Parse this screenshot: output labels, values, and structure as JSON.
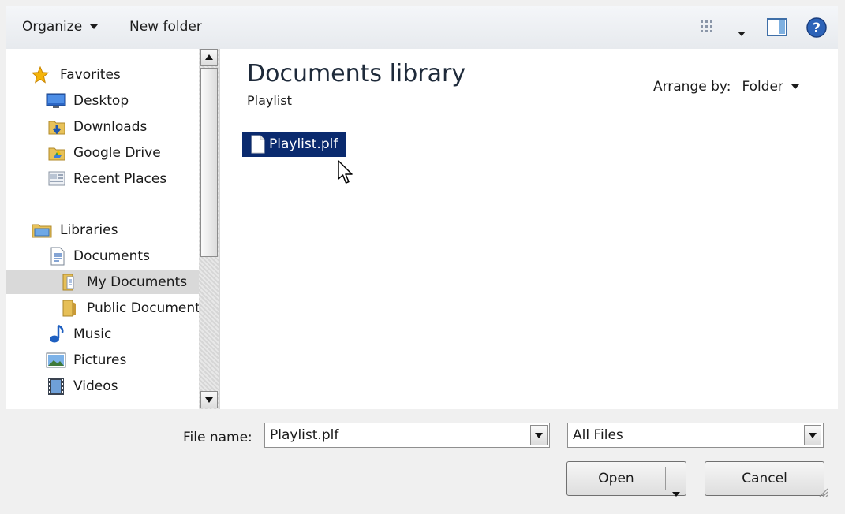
{
  "toolbar": {
    "organize_label": "Organize",
    "new_folder_label": "New folder",
    "icons": [
      "views-icon",
      "view-options-arrow-icon",
      "preview-pane-icon",
      "help-icon"
    ]
  },
  "nav": {
    "favorites": {
      "label": "Favorites",
      "items": [
        {
          "label": "Desktop",
          "icon": "desktop-icon"
        },
        {
          "label": "Downloads",
          "icon": "downloads-icon"
        },
        {
          "label": "Google Drive",
          "icon": "google-drive-icon"
        },
        {
          "label": "Recent Places",
          "icon": "recent-places-icon"
        }
      ]
    },
    "libraries": {
      "label": "Libraries",
      "items": [
        {
          "label": "Documents",
          "icon": "documents-icon"
        },
        {
          "label": "My Documents",
          "icon": "folder-icon",
          "selected": true
        },
        {
          "label": "Public Documents",
          "icon": "folder-icon"
        },
        {
          "label": "Music",
          "icon": "music-icon"
        },
        {
          "label": "Pictures",
          "icon": "pictures-icon"
        },
        {
          "label": "Videos",
          "icon": "videos-icon"
        }
      ]
    }
  },
  "content": {
    "title": "Documents library",
    "subtitle": "Playlist",
    "arrange_label": "Arrange by:",
    "arrange_value": "Folder",
    "files": [
      {
        "name": "Playlist.plf",
        "selected": true
      }
    ]
  },
  "bottom": {
    "file_name_label": "File name:",
    "file_name_value": "Playlist.plf",
    "file_type_value": "All Files",
    "open_label": "Open",
    "cancel_label": "Cancel"
  },
  "colors": {
    "selection": "#0a2a6e",
    "nav_selected": "#d9d9d9",
    "toolbar_bg": "#eef0f3"
  }
}
